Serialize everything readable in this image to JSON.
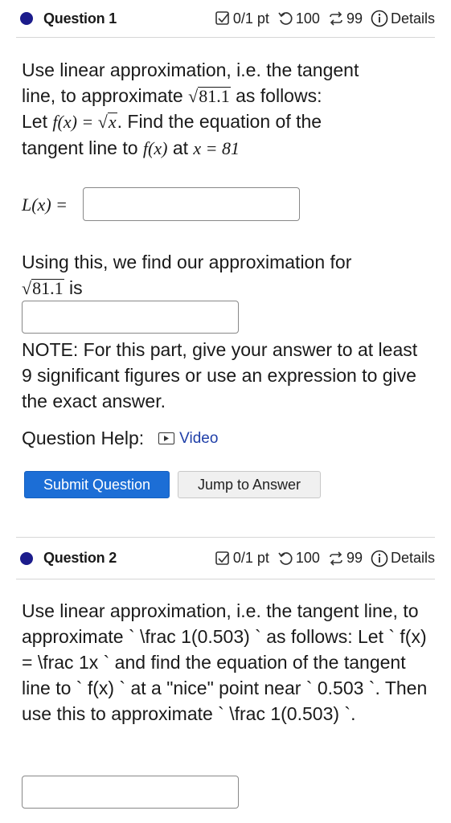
{
  "q1": {
    "title": "Question 1",
    "score": "0/1 pt",
    "retries": "100",
    "attempts": "99",
    "details": "Details",
    "p1_a": "Use linear approximation, i.e. the tangent",
    "p1_b": "line, to approximate ",
    "sqrt_arg": "81.1",
    "p1_c": " as follows:",
    "p1_d": "Let ",
    "fx": "f(x)",
    "eq": " = ",
    "sqrt_x": "x",
    "p1_e": ". Find the equation of the",
    "p1_f": "tangent line to ",
    "p1_g": " at ",
    "x_eq": "x = 81",
    "lx_label": "L(x) =",
    "p2_a": "Using this, we find our approximation for",
    "p2_b": " is",
    "note": "NOTE: For this part, give your answer to at least 9 significant figures or use an expression to give the exact answer.",
    "help_label": "Question Help:",
    "video_label": "Video",
    "submit_label": "Submit Question",
    "jump_label": "Jump to Answer"
  },
  "q2": {
    "title": "Question 2",
    "score": "0/1 pt",
    "retries": "100",
    "attempts": "99",
    "details": "Details",
    "text": "Use linear approximation, i.e. the tangent line, to approximate ` \\frac 1(0.503) ` as follows: Let ` f(x) = \\frac 1x ` and find the equation of the tangent line to ` f(x) ` at a \"nice\" point near ` 0.503 `. Then use this to approximate ` \\frac 1(0.503) `."
  },
  "colors": {
    "accent": "#1c6ed6",
    "dot": "#1c1c8c",
    "link": "#1f3fa8"
  }
}
